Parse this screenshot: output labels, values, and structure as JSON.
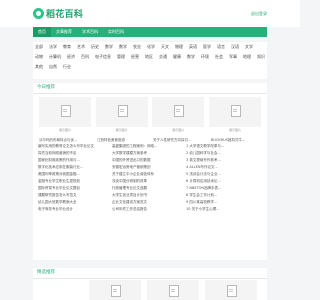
{
  "site": {
    "name": "稻花百科",
    "top_right": "退出登录"
  },
  "nav": [
    "首页",
    "文章推荐",
    "学术百科",
    "实时百科"
  ],
  "categories": [
    [
      "全部",
      "法学",
      "教育",
      "艺术",
      "历史",
      "数学",
      "数学",
      "农业",
      "化学",
      "天文",
      "物理",
      "英语",
      "医学",
      "语言",
      "汉语",
      "文学"
    ],
    [
      "动物",
      "计算机",
      "经济",
      "百科",
      "电子信息",
      "管理",
      "经营",
      "地区",
      "交通",
      "健康",
      "数学",
      "环境",
      "社会",
      "军事",
      "地理",
      "知识"
    ],
    [
      "其他",
      "自然",
      "行业"
    ]
  ],
  "today": {
    "title": "今日推荐",
    "thumbs": [
      {
        "label": "展示图片"
      },
      {
        "label": "展示图片"
      },
      {
        "label": "展示图片"
      },
      {
        "label": "展示图片"
      }
    ],
    "thumb_titles": [
      "沃尔玛的布局特点与优...",
      "江西特色美食旅游",
      "关于人性研究方向探讨...",
      "BUCKRUS锁扣式牛..."
    ],
    "list": [
      [
        "编写实用的教育论文怎么写毕业论文",
        "高盛集团的工程案例：网络...",
        "1 大学语文教学改革与..."
      ],
      [
        "探究当前网络营销的不足",
        "大学数学建模方案参考",
        "2 幼儿园科学与社会..."
      ],
      [
        "国家化财政政策的作用与...",
        "中国的外贸进出口的数据",
        "3 英文提纲写作参考..."
      ],
      [
        "数字化技术应用在服装行业...",
        "安徽宏远房地产营销策划",
        "4 ALLEN写作论文..."
      ],
      [
        "美国利率政策对我国金融...",
        "关于建立中小企业诚信体系",
        "5 浅谈会计法与企业..."
      ],
      [
        "金融专业学生职业生涯规划",
        "浅谈中国分税制的改革",
        "6 计算机应用技术论..."
      ],
      [
        "国际贸易专业毕业论文题目",
        "行政管理专业论文选题",
        "7 NBSTON品牌手表..."
      ],
      [
        "课题研究报告怎么写范文",
        "大学生创业项目计划书",
        "8 学生会工作计划..."
      ],
      [
        "幼儿园大班数学教案大全",
        "企业文化建设方案范文",
        "9 四川某高校教学..."
      ],
      [
        "电子商务专业毕业设计",
        "公司年终工作总结报告",
        "10 关于小学生心理..."
      ]
    ]
  },
  "featured": {
    "title": "精选推荐",
    "thumbs": [
      "展示图片",
      "展示图片",
      "展示图片"
    ]
  }
}
